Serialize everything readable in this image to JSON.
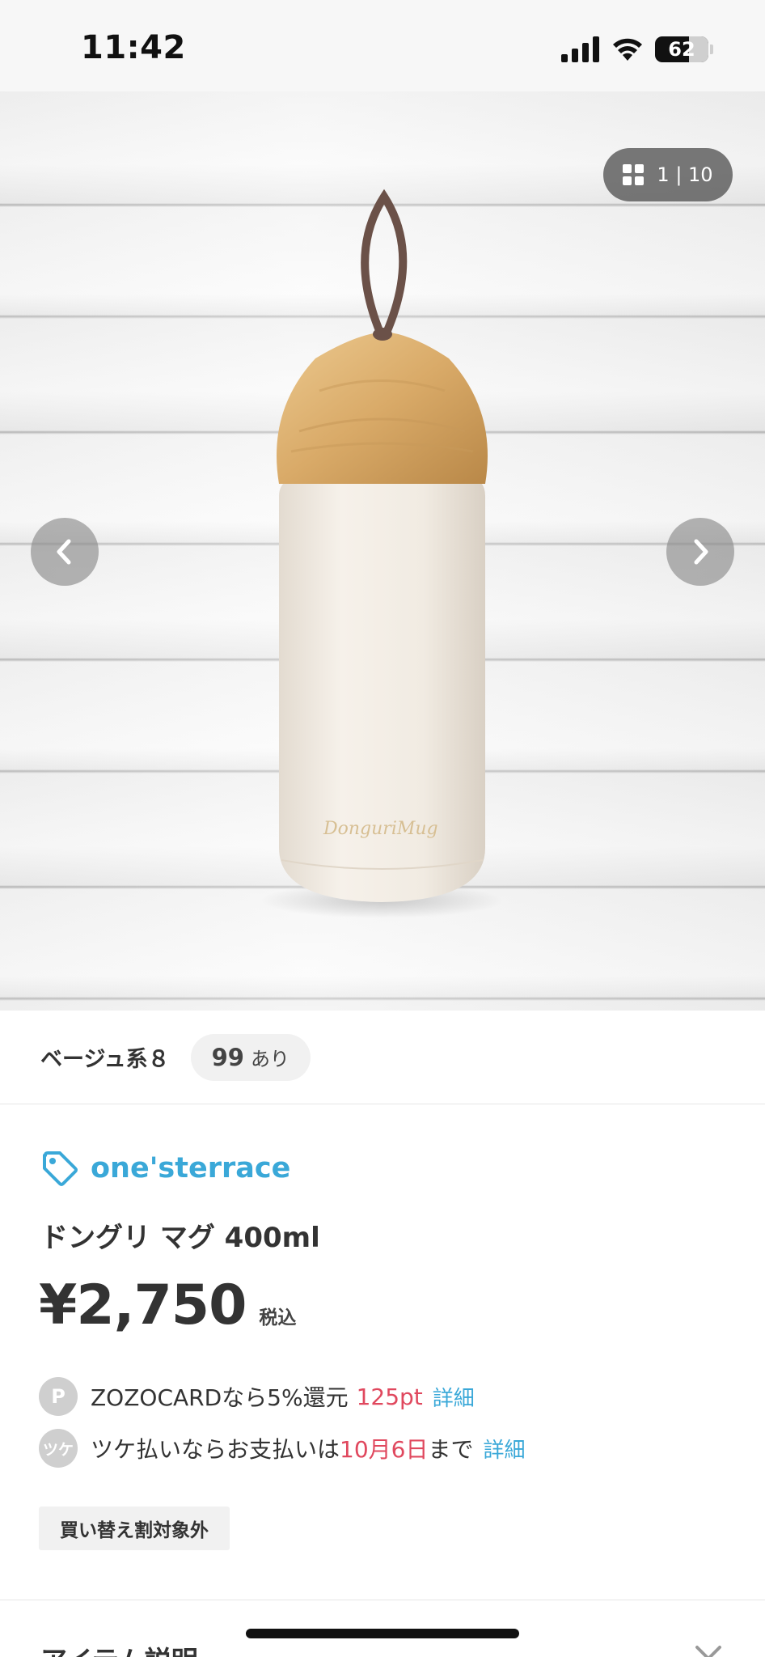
{
  "status_bar": {
    "time": "11:42",
    "battery": "62"
  },
  "gallery": {
    "counter": "1 | 10"
  },
  "variant": {
    "name": "ベージュ系８",
    "stock_count": "99",
    "stock_suffix": "あり"
  },
  "product": {
    "brand": "one'sterrace",
    "name": "ドングリ マグ 400ml",
    "price": "¥2,750",
    "tax_label": "税込"
  },
  "point_info": {
    "icon_label": "P",
    "text": "ZOZOCARDなら5%還元",
    "points": "125pt",
    "link": "詳細"
  },
  "tsuke_info": {
    "icon_label": "ツケ",
    "text_before": "ツケ払いならお支払いは",
    "date": "10月6日",
    "text_after": "まで",
    "link": "詳細"
  },
  "trade_in_badge": "買い替え割対象外",
  "section": {
    "title": "アイテム説明"
  },
  "colors": {
    "accent": "#3aa8d8",
    "highlight": "#e0485e"
  }
}
